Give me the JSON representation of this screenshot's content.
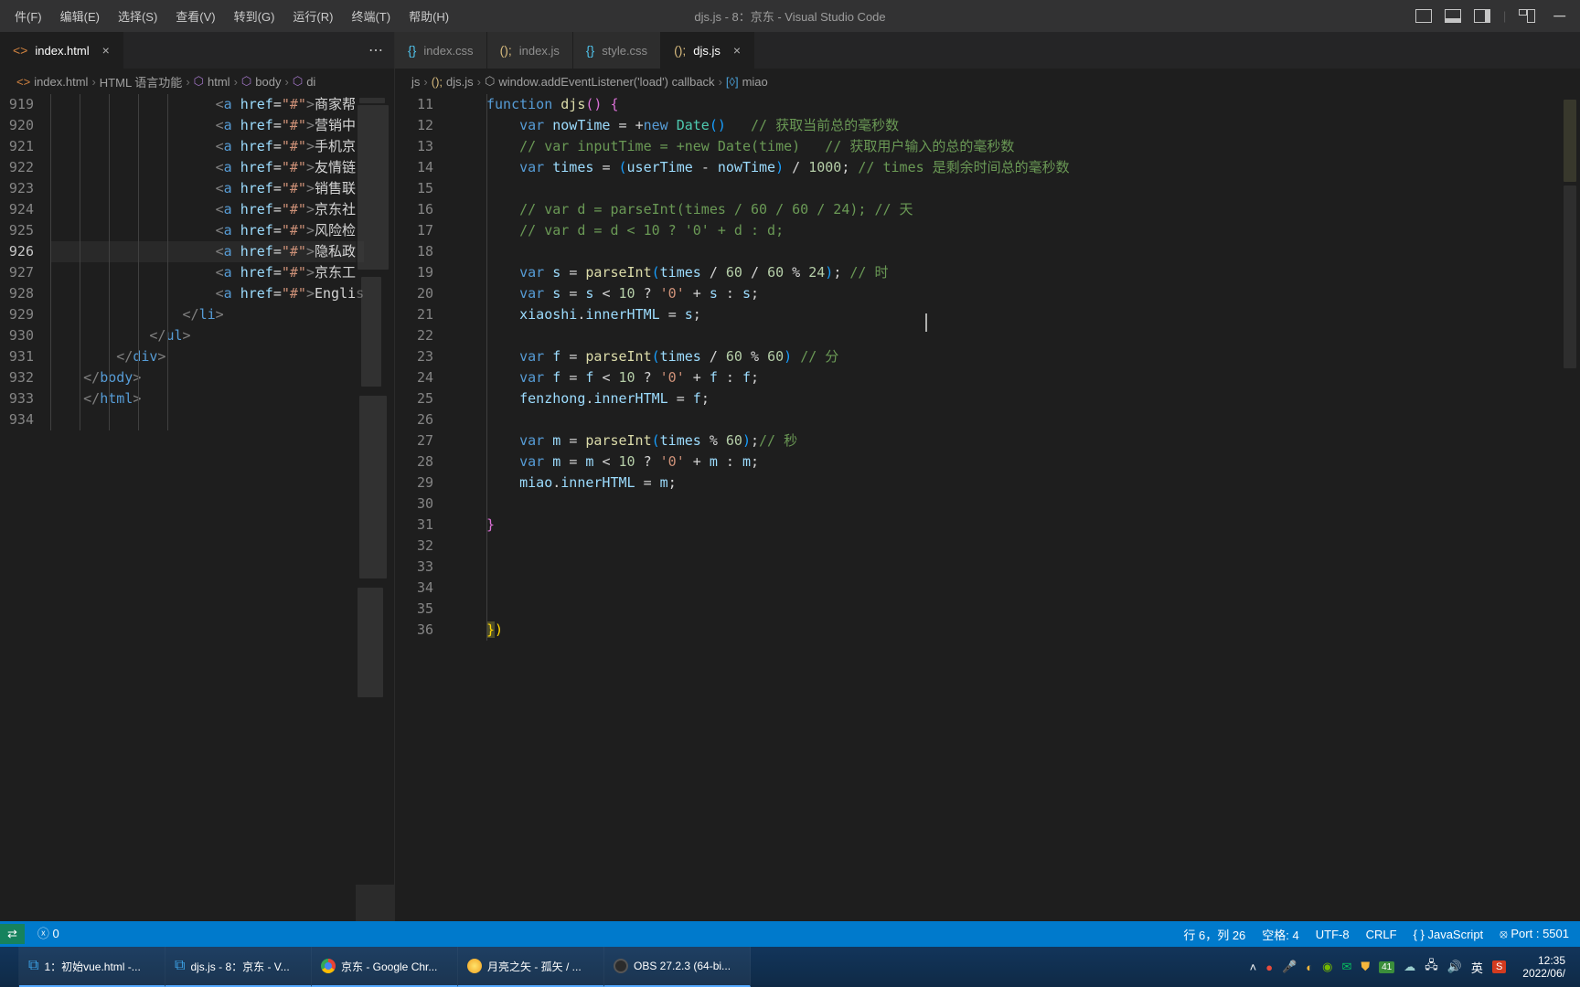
{
  "menubar": {
    "items": [
      "件(F)",
      "编辑(E)",
      "选择(S)",
      "查看(V)",
      "转到(G)",
      "运行(R)",
      "终端(T)",
      "帮助(H)"
    ],
    "title": "djs.js - 8：京东 - Visual Studio Code"
  },
  "left": {
    "tabs": [
      {
        "icon": "<>",
        "label": "index.html",
        "active": true
      }
    ],
    "breadcrumb": [
      "index.html",
      "HTML 语言功能",
      "html",
      "body",
      "di"
    ],
    "lines_start": 919,
    "lines_end": 934,
    "code": [
      {
        "n": 919,
        "indent": 5,
        "a": {
          "href": "#",
          "text": "商家帮"
        }
      },
      {
        "n": 920,
        "indent": 5,
        "a": {
          "href": "#",
          "text": "营销中"
        }
      },
      {
        "n": 921,
        "indent": 5,
        "a": {
          "href": "#",
          "text": "手机京"
        }
      },
      {
        "n": 922,
        "indent": 5,
        "a": {
          "href": "#",
          "text": "友情链"
        }
      },
      {
        "n": 923,
        "indent": 5,
        "a": {
          "href": "#",
          "text": "销售联"
        }
      },
      {
        "n": 924,
        "indent": 5,
        "a": {
          "href": "#",
          "text": "京东社"
        }
      },
      {
        "n": 925,
        "indent": 5,
        "a": {
          "href": "#",
          "text": "风险检"
        }
      },
      {
        "n": 926,
        "indent": 5,
        "a": {
          "href": "#",
          "text": "隐私政"
        },
        "hl": true
      },
      {
        "n": 927,
        "indent": 5,
        "a": {
          "href": "#",
          "text": "京东工"
        }
      },
      {
        "n": 928,
        "indent": 5,
        "a": {
          "href": "#",
          "text": "Englis"
        }
      },
      {
        "n": 929,
        "indent": 4,
        "close": "li"
      },
      {
        "n": 930,
        "indent": 3,
        "close": "ul"
      },
      {
        "n": 931,
        "indent": 2,
        "close": "div"
      },
      {
        "n": 932,
        "indent": 1,
        "close": "body"
      },
      {
        "n": 933,
        "indent": 0,
        "blank": true
      },
      {
        "n": 934,
        "indent": 1,
        "close": "html"
      }
    ]
  },
  "right": {
    "tabs": [
      {
        "icon": "{}",
        "label": "index.css",
        "color": "cyan"
      },
      {
        "icon": "();",
        "label": "index.js",
        "color": "yellow"
      },
      {
        "icon": "{}",
        "label": "style.css",
        "color": "cyan"
      },
      {
        "icon": "();",
        "label": "djs.js",
        "color": "yellow",
        "active": true
      }
    ],
    "breadcrumb": [
      "js",
      "djs.js",
      "window.addEventListener('load') callback",
      "miao"
    ],
    "code_lines": [
      11,
      12,
      13,
      14,
      15,
      16,
      17,
      18,
      19,
      20,
      21,
      22,
      23,
      24,
      25,
      26,
      27,
      28,
      29,
      30,
      31,
      32,
      33,
      34,
      35,
      36
    ]
  },
  "status": {
    "left_items": [
      "0"
    ],
    "right_items": [
      "行 6，列 26",
      "空格: 4",
      "UTF-8",
      "CRLF",
      "{ } JavaScript",
      "Port : 5501"
    ]
  },
  "taskbar": {
    "apps": [
      {
        "label": "1：初始vue.html -...",
        "icon": "vscode"
      },
      {
        "label": "djs.js - 8：京东 - V...",
        "icon": "vscode"
      },
      {
        "label": "京东 - Google Chr...",
        "icon": "chrome"
      },
      {
        "label": "月亮之矢 - 孤矢 / ...",
        "icon": "music"
      },
      {
        "label": "OBS 27.2.3 (64-bi...",
        "icon": "obs"
      }
    ],
    "tray_badge": "41",
    "tray_lang": "英",
    "clock_time": "12:35",
    "clock_date": "2022/06/"
  }
}
